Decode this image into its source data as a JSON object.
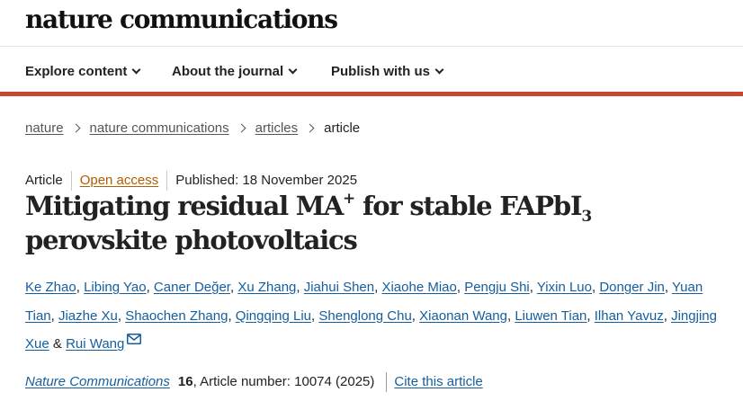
{
  "header": {
    "brand": "nature communications"
  },
  "nav": {
    "items": [
      {
        "label": "Explore content"
      },
      {
        "label": "About the journal"
      },
      {
        "label": "Publish with us"
      }
    ]
  },
  "breadcrumb": {
    "items": [
      {
        "label": "nature"
      },
      {
        "label": "nature communications"
      },
      {
        "label": "articles"
      }
    ],
    "current": "article"
  },
  "article": {
    "type": "Article",
    "access": "Open access",
    "published": "Published: 18 November 2025",
    "title": {
      "part1": "Mitigating residual MA",
      "sup": "+",
      "part2": " for stable FAPbI",
      "sub": "3",
      "part3": " perovskite photovoltaics"
    },
    "authors": [
      "Ke Zhao",
      "Libing Yao",
      "Caner Değer",
      "Xu Zhang",
      "Jiahui Shen",
      "Xiaohe Miao",
      "Pengju Shi",
      "Yixin Luo",
      "Donger Jin",
      "Yuan Tian",
      "Jiazhe Xu",
      "Shaochen Zhang",
      "Qingqing Liu",
      "Shenglong Chu",
      "Xiaonan Wang",
      "Liuwen Tian",
      "Ilhan Yavuz",
      "Jingjing Xue",
      "Rui Wang"
    ],
    "author_conjunction": "&",
    "citation": {
      "journal": "Nature Communications",
      "volume": "16",
      "article_number": ", Article number: 10074 (2025)",
      "cite_label": "Cite this article"
    }
  },
  "colors": {
    "accent_bar": "#c8462b",
    "link": "#155e9e",
    "open_access": "#b35c00"
  }
}
